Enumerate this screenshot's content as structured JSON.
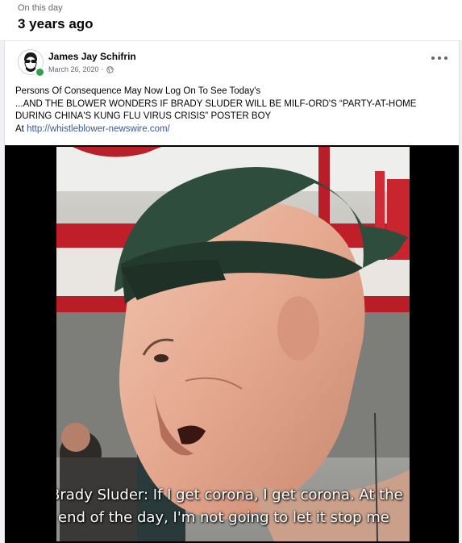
{
  "memory": {
    "label": "On this day",
    "title": "3 years ago"
  },
  "post": {
    "author": "James Jay Schifrin",
    "date": "March 26, 2020",
    "separator": "·",
    "privacy_icon": "globe-icon",
    "more_icon": "more-options-icon",
    "text_lines": [
      "Persons Of Consequence May Now Log On To See Today's",
      "...AND THE BLOWER WONDERS IF BRADY SLUDER WILL BE MILF-ORD'S “PARTY-AT-HOME",
      "DURING CHINA'S KUNG FLU VIRUS CRISIS” POSTER BOY"
    ],
    "link_prefix": "At ",
    "link_text": "http://whistleblower-newswire.com/"
  },
  "video": {
    "subtitle_line1": "Brady Sluder: If I get corona, I get corona. At the",
    "subtitle_line2": "end of the day, I'm not going to let it stop me"
  },
  "colors": {
    "link": "#385898",
    "online": "#31a24c",
    "cap": "#2f4d3c"
  }
}
